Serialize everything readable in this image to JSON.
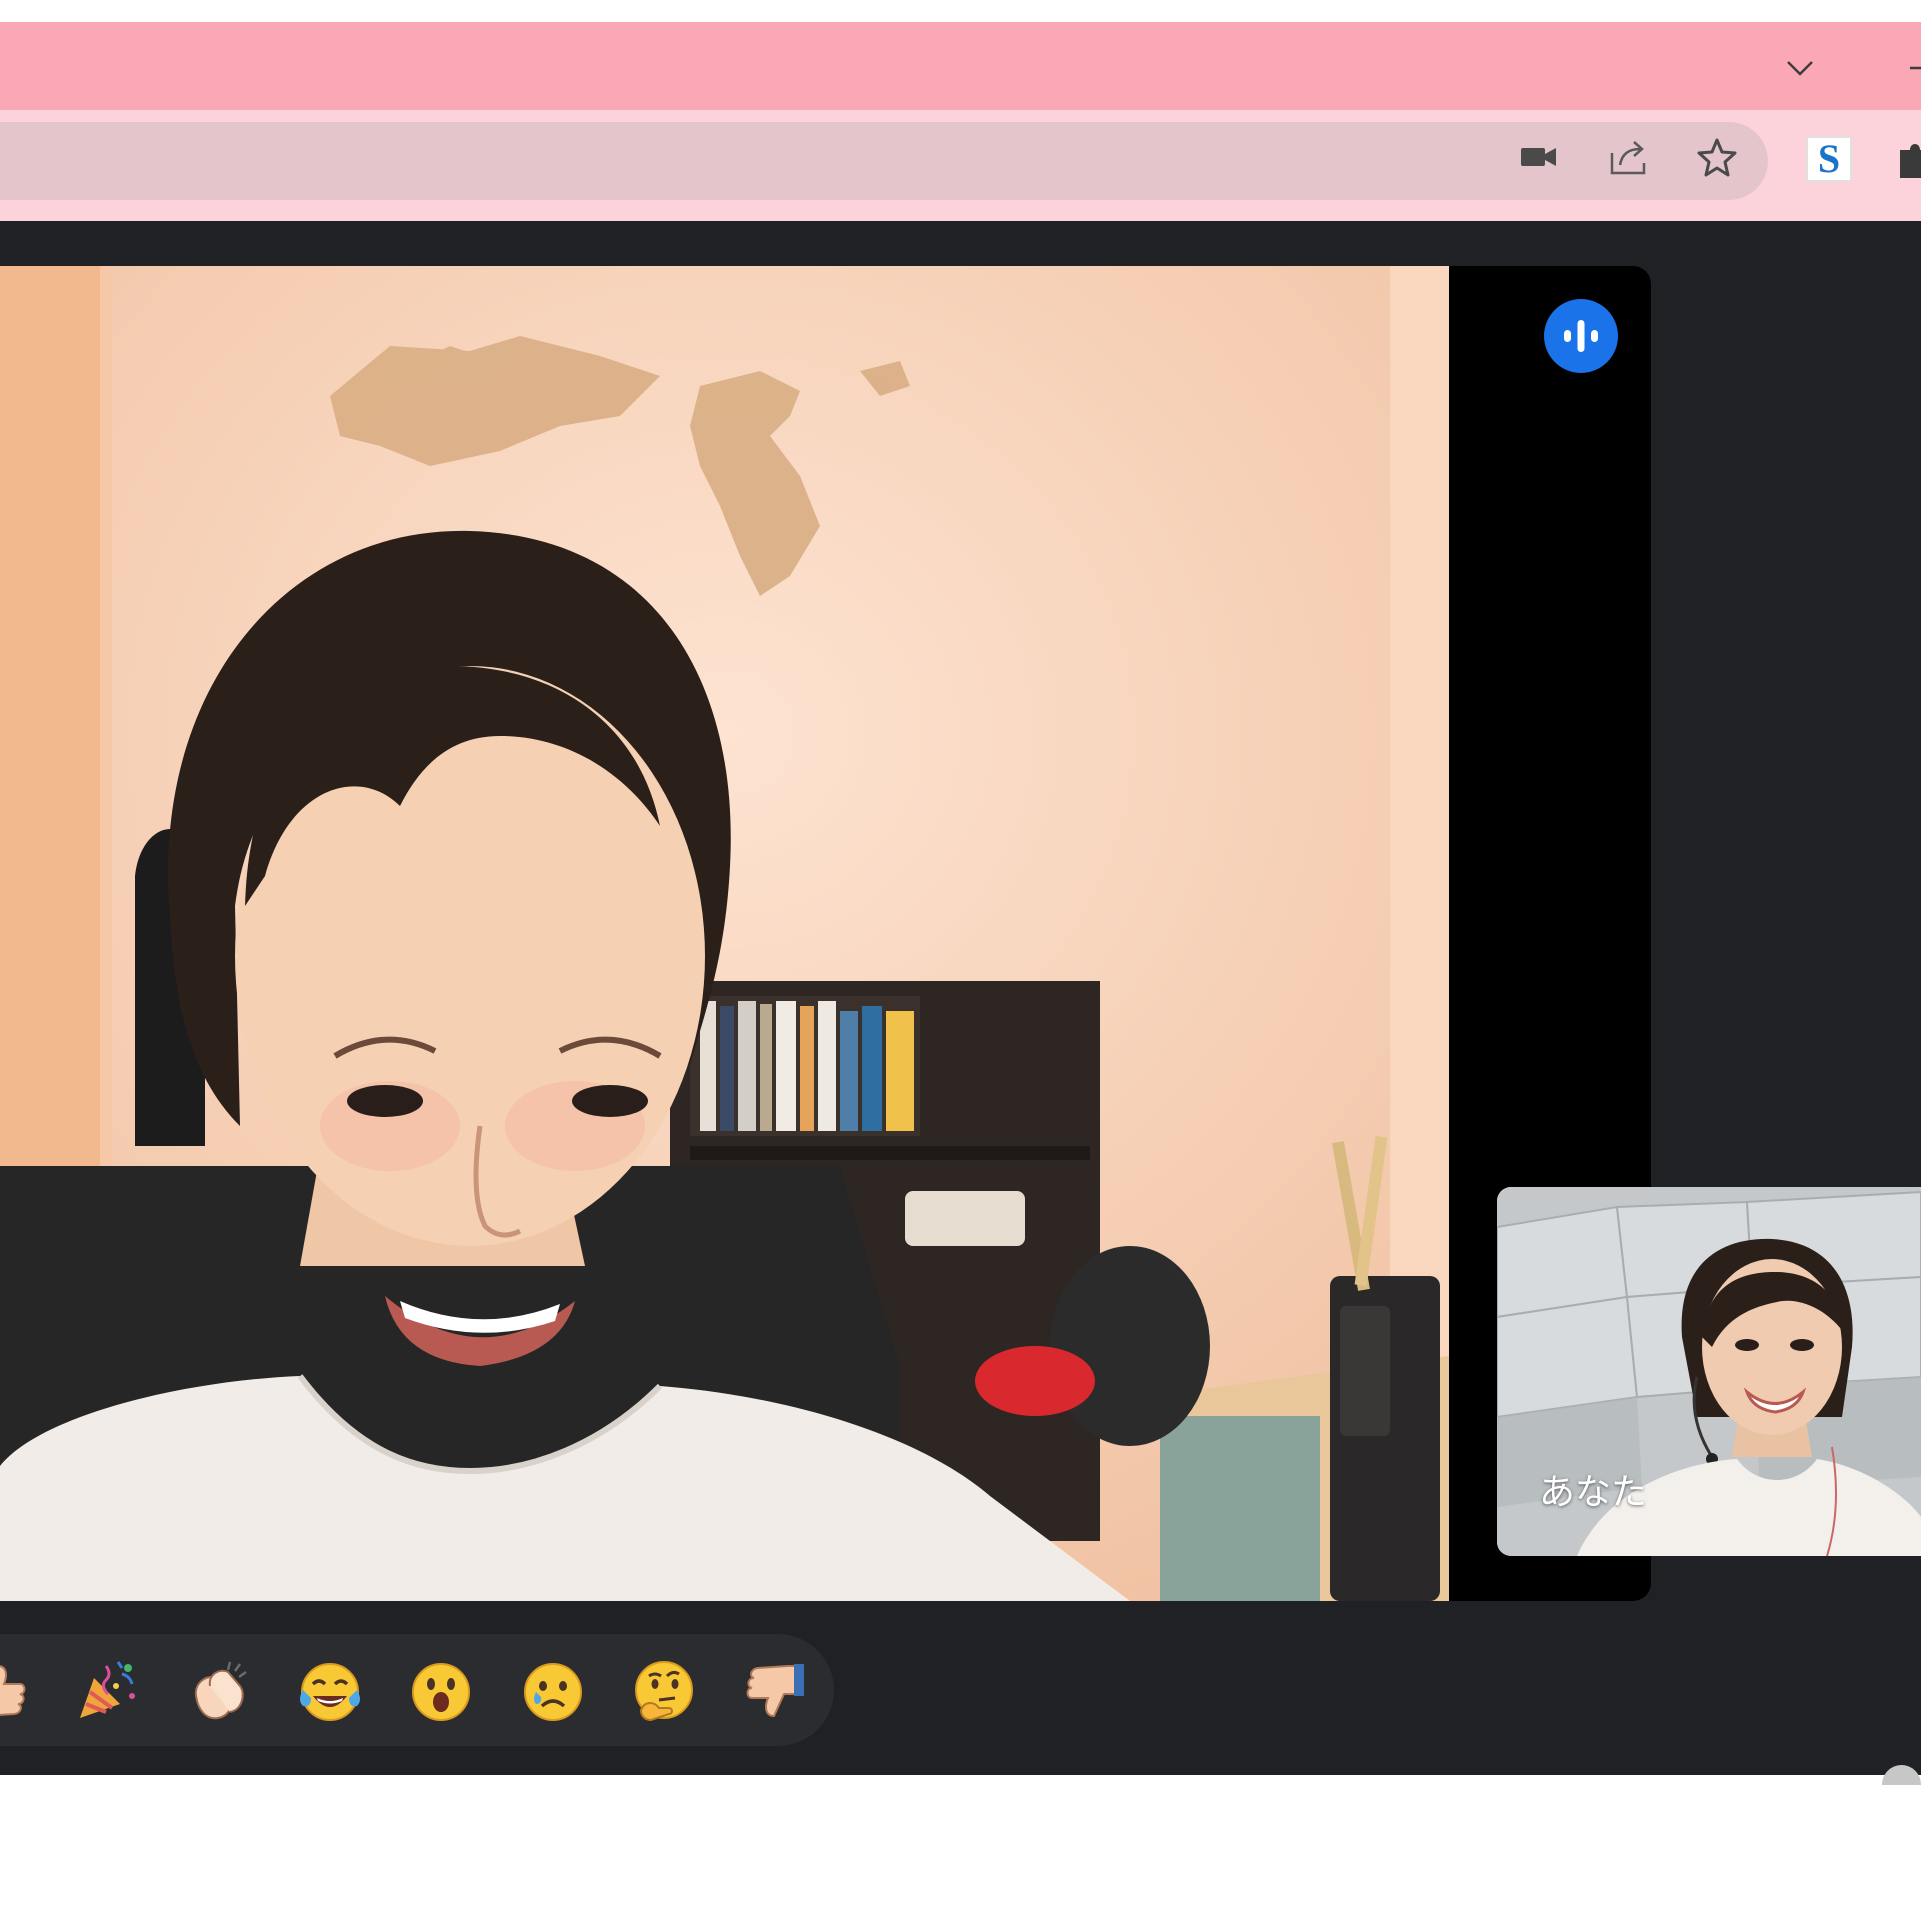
{
  "browser": {
    "accent_titlebar": "#fba8b6",
    "accent_toolbar": "#fdd3db",
    "icons": [
      "tab-search-chevron-icon",
      "minimize-icon",
      "camera-in-use-icon",
      "share-icon",
      "bookmark-star-icon",
      "extension-s-icon",
      "extensions-puzzle-icon"
    ],
    "extension_letter": "S"
  },
  "meeting": {
    "background": "#202124",
    "speaking_indicator_color": "#1a73e8",
    "self_view_label": "あなた"
  },
  "reactions": {
    "items": [
      {
        "name": "thumbs-up",
        "glyph": "👍"
      },
      {
        "name": "party-popper",
        "glyph": "🎉"
      },
      {
        "name": "clapping-hands",
        "glyph": "👏"
      },
      {
        "name": "tears-of-joy",
        "glyph": "😂"
      },
      {
        "name": "surprised",
        "glyph": "😮"
      },
      {
        "name": "sad",
        "glyph": "😢"
      },
      {
        "name": "thinking",
        "glyph": "🤔"
      },
      {
        "name": "thumbs-down",
        "glyph": "👎"
      }
    ]
  }
}
